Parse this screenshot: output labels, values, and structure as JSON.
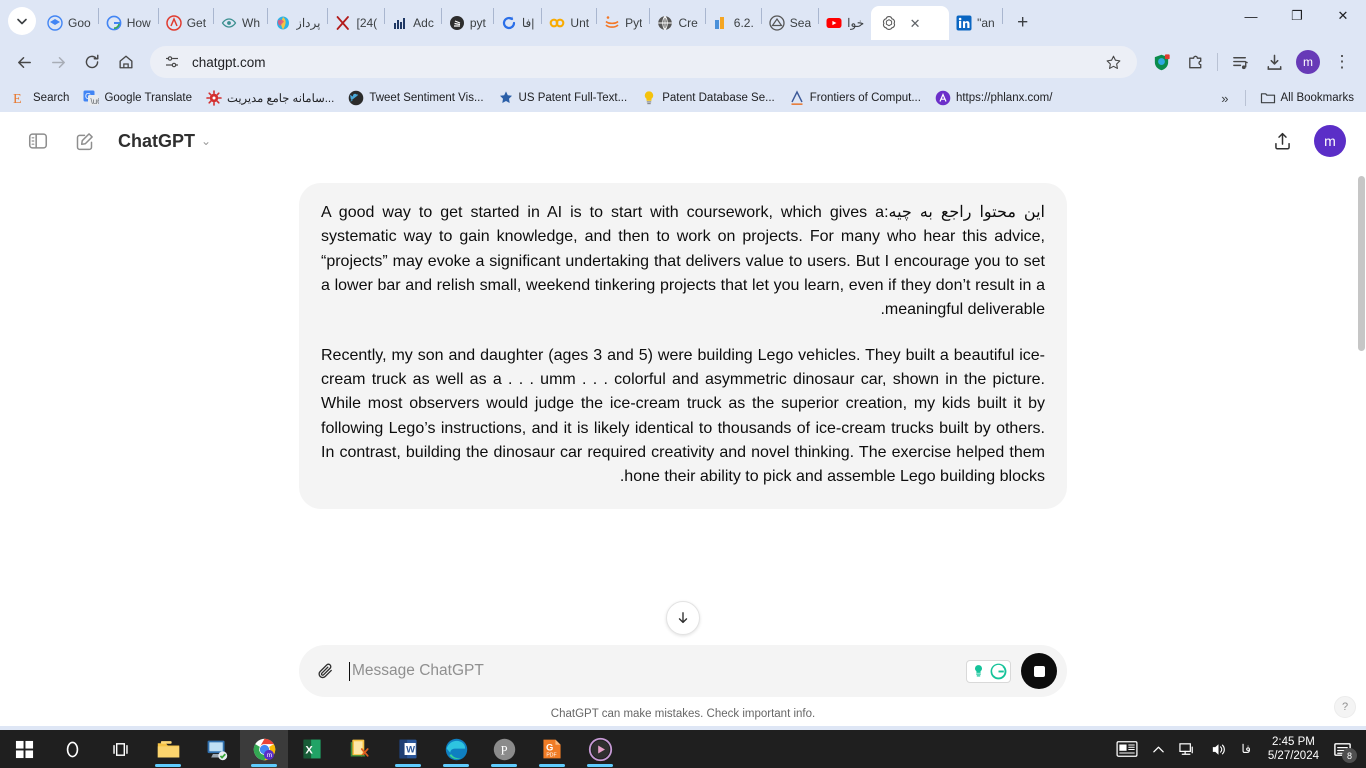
{
  "browser": {
    "window_controls": {
      "minimize": "—",
      "maximize": "❐",
      "close": "✕"
    },
    "tab_list_label": "⌄",
    "new_tab_label": "+",
    "tabs": [
      {
        "title": "Goo",
        "icon": "google-scholar-icon",
        "active": false
      },
      {
        "title": "How",
        "icon": "google-icon",
        "active": false
      },
      {
        "title": "Get",
        "icon": "red-circle-icon",
        "active": false
      },
      {
        "title": "Wh",
        "icon": "eye-icon",
        "active": false
      },
      {
        "title": "پرداز",
        "icon": "copilot-icon",
        "active": false
      },
      {
        "title": "[24(",
        "icon": "arxiv-icon",
        "active": false
      },
      {
        "title": "Adc",
        "icon": "chart-icon",
        "active": false
      },
      {
        "title": "pyt",
        "icon": "stack-overflow-icon",
        "active": false
      },
      {
        "title": "فا|",
        "icon": "refresh-blue-icon",
        "active": false
      },
      {
        "title": "Unt",
        "icon": "colab-icon",
        "active": false
      },
      {
        "title": "Pyt",
        "icon": "jupyter-icon",
        "active": false
      },
      {
        "title": "Cre",
        "icon": "globe-icon",
        "active": false
      },
      {
        "title": "6.2.",
        "icon": "bar-chart-icon",
        "active": false
      },
      {
        "title": "Sea",
        "icon": "academia-icon",
        "active": false
      },
      {
        "title": "خوا",
        "icon": "youtube-icon",
        "active": false
      },
      {
        "title": "",
        "icon": "openai-icon",
        "active": true,
        "close_label": "✕"
      },
      {
        "title": "\"an",
        "icon": "linkedin-icon",
        "active": false
      }
    ],
    "toolbar": {
      "back_label": "←",
      "forward_label": "→",
      "reload_label": "⟳",
      "home_label": "home-icon",
      "url": "chatgpt.com",
      "site_settings_icon": "tune-icon",
      "bookmark_star_icon": "star-icon",
      "extensions": [
        {
          "name": "adblock-shield-icon"
        },
        {
          "name": "extensions-puzzle-icon"
        },
        {
          "name": "media-queue-icon"
        },
        {
          "name": "downloads-icon"
        }
      ],
      "profile_initial": "m",
      "menu_label": "⋮"
    },
    "bookmarks": [
      {
        "label": "Search",
        "icon": "e-search-icon"
      },
      {
        "label": "Google Translate",
        "icon": "google-translate-icon"
      },
      {
        "label": "سامانه جامع مديريت...",
        "icon": "gear-red-icon"
      },
      {
        "label": "Tweet Sentiment Vis...",
        "icon": "bird-dark-icon"
      },
      {
        "label": "US Patent Full-Text...",
        "icon": "patent-star-icon"
      },
      {
        "label": "Patent Database Se...",
        "icon": "lightbulb-icon"
      },
      {
        "label": "Frontiers of Comput...",
        "icon": "frontiers-icon"
      },
      {
        "label": "https://phlanx.com/",
        "icon": "phlanx-icon"
      }
    ],
    "bookmarks_overflow_label": "»",
    "all_bookmarks_label": "All Bookmarks",
    "all_bookmarks_icon": "folder-icon"
  },
  "chatgpt": {
    "header": {
      "sidebar_toggle_icon": "sidebar-toggle-icon",
      "new_chat_icon": "new-chat-pencil-icon",
      "brand": "ChatGPT",
      "brand_chevron": "⌄",
      "share_icon": "share-upload-icon",
      "profile_initial": "m"
    },
    "message": {
      "prompt_fa": "این محتوا راجع به چیه:",
      "paragraph1": "A good way to get started in AI is to start with coursework, which gives a systematic way to gain knowledge, and then to work on projects. For many who hear this advice, “projects” may evoke a significant undertaking that delivers value to users. But I encourage you to set a lower bar and relish small, weekend tinkering projects that let you learn, even if they don’t result in a meaningful deliverable.",
      "paragraph2": "Recently, my son and daughter (ages 3 and 5) were building Lego vehicles. They built a beautiful ice-cream truck as well as a . . . umm . . . colorful and asymmetric dinosaur car, shown in the picture. While most observers would judge the ice-cream truck as the superior creation, my kids built it by following Lego’s instructions, and it is likely identical to thousands of ice-cream trucks built by others. In contrast, building the dinosaur car required creativity and novel thinking. The exercise helped them hone their ability to pick and assemble Lego building blocks."
    },
    "scroll_to_bottom_icon": "arrow-down-icon",
    "composer": {
      "attach_icon": "paperclip-icon",
      "placeholder": "Message ChatGPT",
      "value": "",
      "grammarly_icons": [
        "grammarly-tip-icon",
        "grammarly-logo-icon"
      ],
      "stop_button_icon": "stop-square-icon"
    },
    "footnote": "ChatGPT can make mistakes. Check important info.",
    "help_label": "?"
  },
  "taskbar": {
    "items": [
      {
        "name": "start-button",
        "icon": "windows-logo-icon",
        "active": false,
        "running": false
      },
      {
        "name": "search-button",
        "icon": "search-circle-icon",
        "active": false,
        "running": false
      },
      {
        "name": "task-view-button",
        "icon": "task-view-icon",
        "active": false,
        "running": false
      },
      {
        "name": "file-explorer",
        "icon": "folder-icon",
        "active": false,
        "running": true
      },
      {
        "name": "remote-desktop",
        "icon": "monitor-icon",
        "active": false,
        "running": false
      },
      {
        "name": "google-chrome",
        "icon": "chrome-icon",
        "active": true,
        "running": true
      },
      {
        "name": "microsoft-excel",
        "icon": "excel-icon",
        "active": false,
        "running": false
      },
      {
        "name": "snipping-tool",
        "icon": "snip-icon",
        "active": false,
        "running": false
      },
      {
        "name": "microsoft-word",
        "icon": "word-icon",
        "active": false,
        "running": true
      },
      {
        "name": "microsoft-edge",
        "icon": "edge-icon",
        "active": false,
        "running": true
      },
      {
        "name": "pdf-reader",
        "icon": "p-circle-icon",
        "active": false,
        "running": true
      },
      {
        "name": "pdf-converter",
        "icon": "pdf-g-icon",
        "active": false,
        "running": true
      },
      {
        "name": "media-player",
        "icon": "play-circle-icon",
        "active": false,
        "running": true
      }
    ],
    "tray": {
      "news_icon": "news-weather-icon",
      "chevron_label": "⌃",
      "network_icon": "network-icon",
      "volume_icon": "volume-icon",
      "language": "فا",
      "time": "2:45 PM",
      "date": "5/27/2024",
      "notification_icon": "notification-icon",
      "notification_count": "8"
    }
  },
  "colors": {
    "chrome_ui": "#dee6f5",
    "accent_purple": "#5b2ec7",
    "bubble_bg": "#f4f4f4",
    "taskbar_bg": "#1f1f1f",
    "taskbar_accent": "#60cdff"
  }
}
